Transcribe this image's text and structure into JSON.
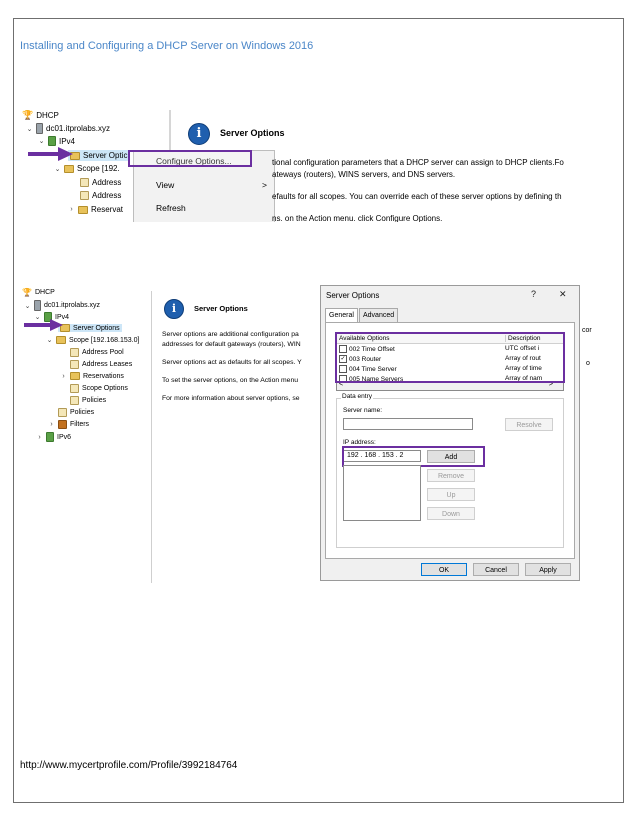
{
  "document": {
    "title": "Installing and Configuring a DHCP Server on Windows 2016",
    "footer_url": "http://www.mycertprofile.com/Profile/3992184764"
  },
  "shot1": {
    "tree": [
      {
        "label": "DHCP"
      },
      {
        "label": "dc01.itprolabs.xyz"
      },
      {
        "label": "IPv4"
      },
      {
        "label": "Server Optic"
      },
      {
        "label": "Scope [192."
      },
      {
        "label": "Address"
      },
      {
        "label": "Address"
      },
      {
        "label": "Reservat"
      }
    ],
    "context_menu": {
      "items": [
        "Configure Options...",
        "View",
        "Refresh"
      ],
      "submenu_glyph": ">"
    },
    "pane": {
      "title": "Server Options",
      "line1": "tional configuration parameters that a DHCP server can assign to DHCP clients.Fo",
      "line2": "ateways (routers), WINS servers, and DNS servers.",
      "line3": "efaults for all scopes.  You can override each of these server options by defining th",
      "line4": "ns. on the Action menu. click Configure Options."
    }
  },
  "shot2": {
    "tree": [
      {
        "label": "DHCP"
      },
      {
        "label": "dc01.itprolabs.xyz"
      },
      {
        "label": "IPv4"
      },
      {
        "label": "Server Options"
      },
      {
        "label": "Scope [192.168.153.0]"
      },
      {
        "label": "Address Pool"
      },
      {
        "label": "Address Leases"
      },
      {
        "label": "Reservations"
      },
      {
        "label": "Scope Options"
      },
      {
        "label": "Policies"
      },
      {
        "label": "Policies"
      },
      {
        "label": "Filters"
      },
      {
        "label": "IPv6"
      }
    ],
    "pane": {
      "title": "Server Options",
      "p1a": "Server options are additional configuration pa",
      "p1b": "addresses for default gateways (routers), WIN",
      "p2": "Server options act as defaults for all scopes.  Y",
      "p3": "To set the server options, on the Action menu",
      "p4": "For more information about server options, se"
    },
    "dialog": {
      "title": "Server Options",
      "help": "?",
      "close": "✕",
      "tabs": [
        "General",
        "Advanced"
      ],
      "list_header": {
        "col1": "Available Options",
        "col2": "Description"
      },
      "options": [
        {
          "label": "002 Time Offset",
          "desc": "UTC offset i",
          "checked": false
        },
        {
          "label": "003 Router",
          "desc": "Array of rout",
          "checked": true
        },
        {
          "label": "004 Time Server",
          "desc": "Array of time",
          "checked": false
        },
        {
          "label": "005 Name Servers",
          "desc": "Array of nam",
          "checked": false
        }
      ],
      "scroll_left": "<",
      "scroll_right": ">",
      "data_entry_legend": "Data entry",
      "server_name_label": "Server name:",
      "resolve": "Resolve",
      "ip_label": "IP address:",
      "ip_value": "192 . 168 . 153 .  2",
      "add": "Add",
      "remove": "Remove",
      "up": "Up",
      "down": "Down",
      "ok": "OK",
      "cancel": "Cancel",
      "apply": "Apply"
    },
    "edge_text_top": "cor",
    "edge_text_mid": "o"
  },
  "colors": {
    "title_blue": "#4a86c8",
    "highlight_purple": "#6b2fa0",
    "info_blue": "#1f5fae"
  },
  "icons": [
    "dhcp-trophy-icon",
    "server-icon",
    "ipv4-icon",
    "folder-icon",
    "info-icon",
    "arrow-icon",
    "checkbox-icon"
  ]
}
